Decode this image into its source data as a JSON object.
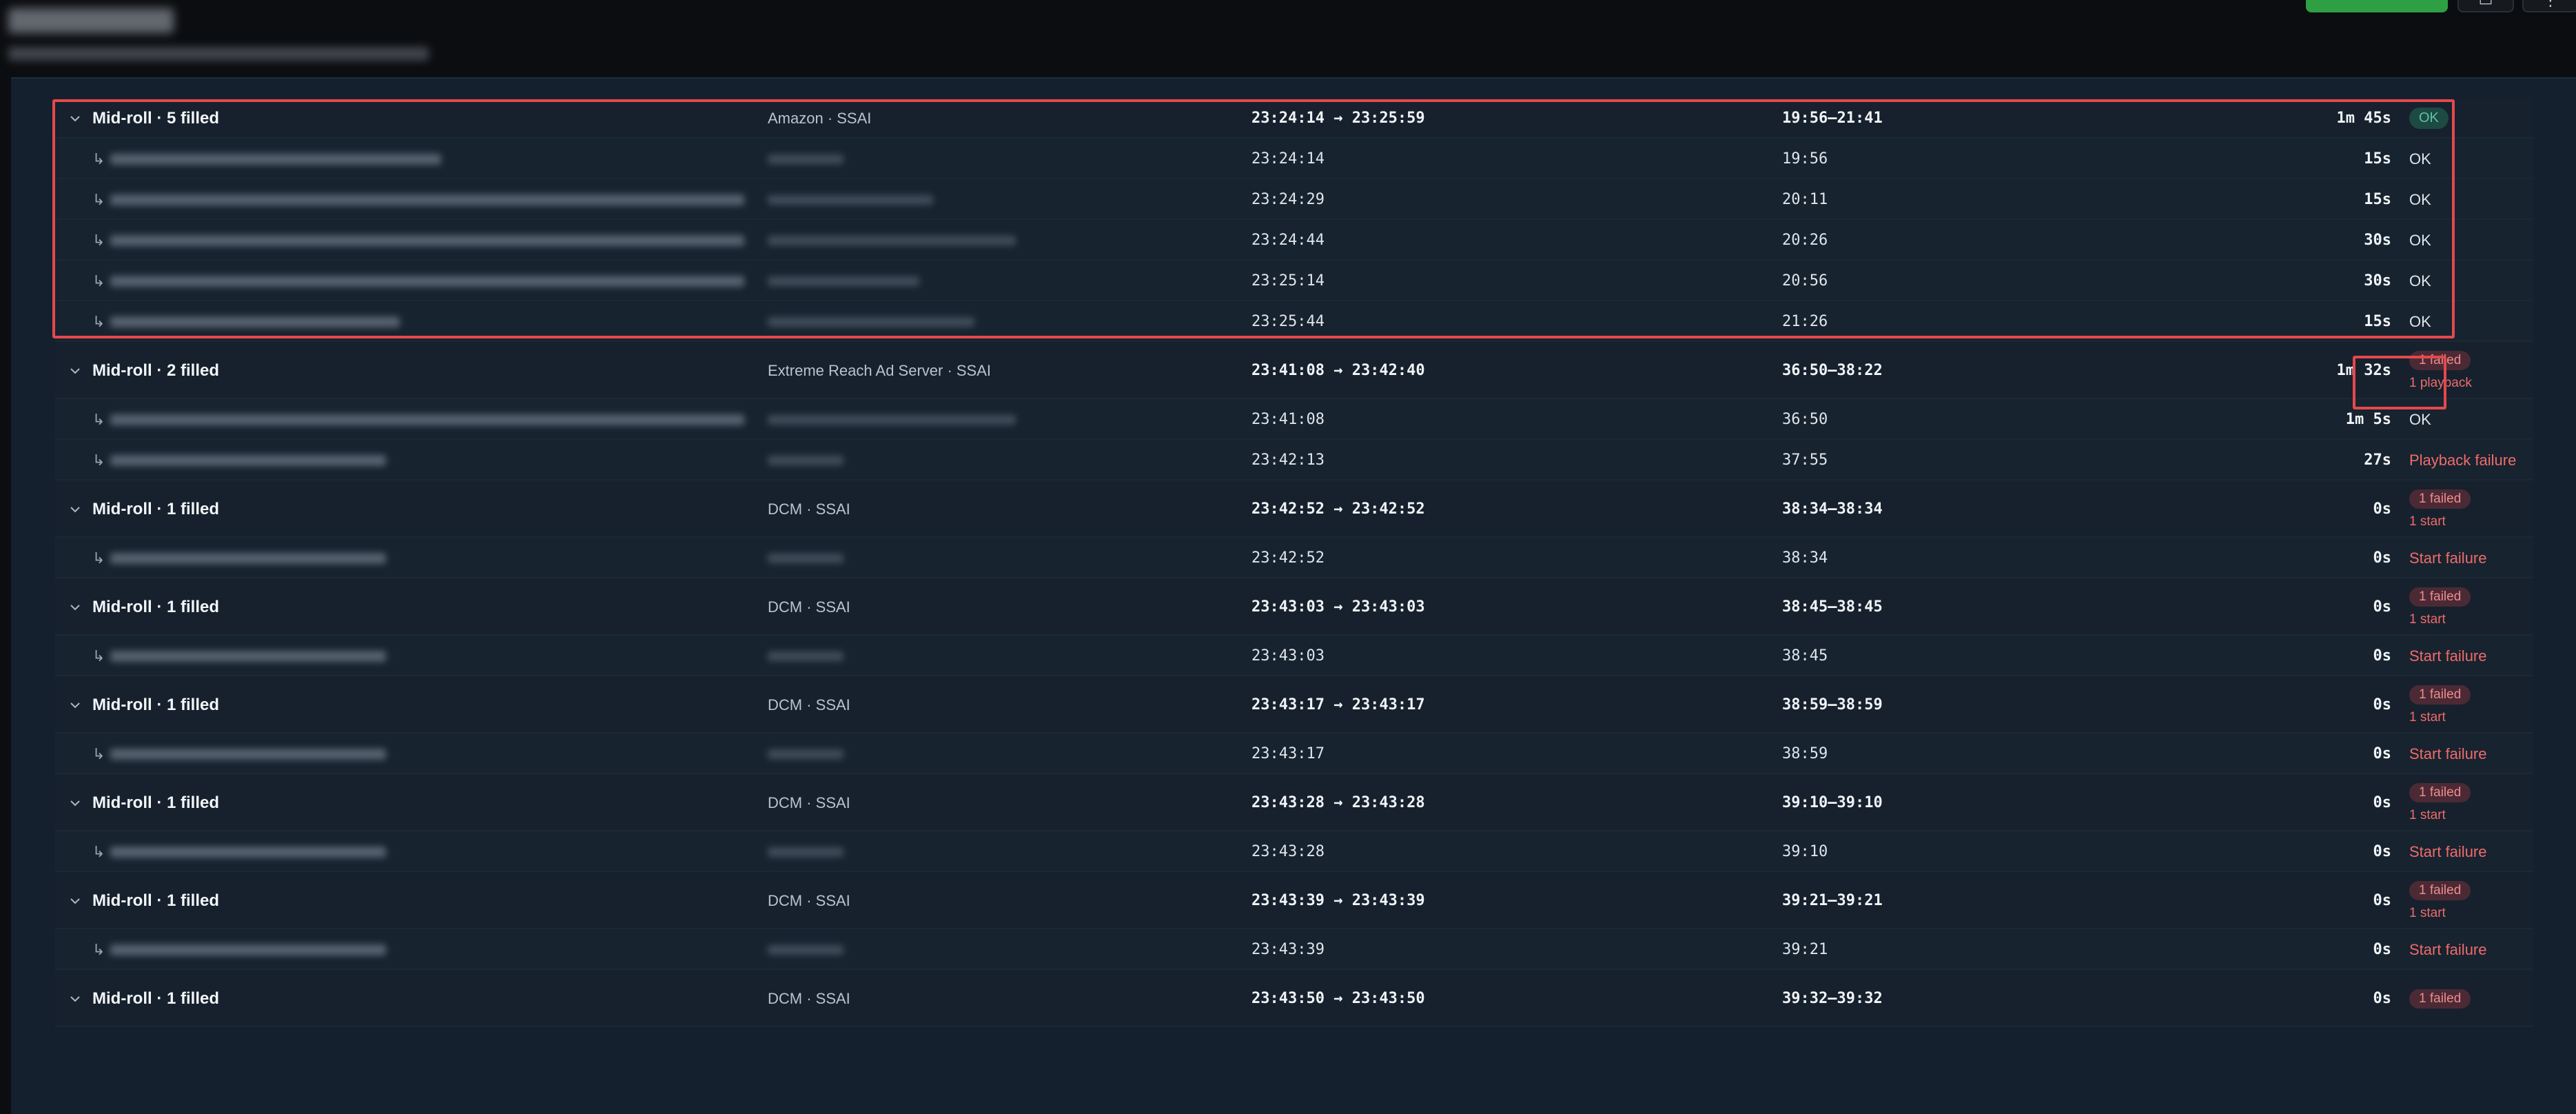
{
  "header": {
    "action_icons": [
      "panel-icon",
      "more-icon"
    ]
  },
  "rows": [
    {
      "kind": "group",
      "name": "Mid-roll · 5 filled",
      "provider": "Amazon · SSAI",
      "time": "23:24:14 → 23:25:59",
      "media": "19:56–21:41",
      "duration": "1m 45s",
      "status": "OK",
      "status_style": "pill-ok"
    },
    {
      "kind": "child",
      "blur": 480,
      "prov_blur": 110,
      "time": "23:24:14",
      "media": "19:56",
      "duration": "15s",
      "status": "OK"
    },
    {
      "kind": "child",
      "blur": 920,
      "prov_blur": 240,
      "time": "23:24:29",
      "media": "20:11",
      "duration": "15s",
      "status": "OK"
    },
    {
      "kind": "child",
      "blur": 920,
      "prov_blur": 360,
      "time": "23:24:44",
      "media": "20:26",
      "duration": "30s",
      "status": "OK"
    },
    {
      "kind": "child",
      "blur": 920,
      "prov_blur": 220,
      "time": "23:25:14",
      "media": "20:56",
      "duration": "30s",
      "status": "OK"
    },
    {
      "kind": "child",
      "blur": 420,
      "prov_blur": 300,
      "time": "23:25:44",
      "media": "21:26",
      "duration": "15s",
      "status": "OK"
    },
    {
      "kind": "group",
      "name": "Mid-roll · 2 filled",
      "provider": "Extreme Reach Ad Server · SSAI",
      "time": "23:41:08 → 23:42:40",
      "media": "36:50–38:22",
      "duration": "1m 32s",
      "status_pill": "1 failed",
      "status_sub": "1 playback"
    },
    {
      "kind": "child",
      "blur": 920,
      "prov_blur": 360,
      "time": "23:41:08",
      "media": "36:50",
      "duration": "1m 5s",
      "status": "OK"
    },
    {
      "kind": "child",
      "blur": 400,
      "prov_blur": 110,
      "time": "23:42:13",
      "media": "37:55",
      "duration": "27s",
      "status": "Playback failure",
      "status_style": "fail"
    },
    {
      "kind": "group",
      "name": "Mid-roll · 1 filled",
      "provider": "DCM · SSAI",
      "time": "23:42:52 → 23:42:52",
      "media": "38:34–38:34",
      "duration": "0s",
      "status_pill": "1 failed",
      "status_sub": "1 start"
    },
    {
      "kind": "child",
      "blur": 400,
      "prov_blur": 110,
      "time": "23:42:52",
      "media": "38:34",
      "duration": "0s",
      "status": "Start failure",
      "status_style": "fail"
    },
    {
      "kind": "group",
      "name": "Mid-roll · 1 filled",
      "provider": "DCM · SSAI",
      "time": "23:43:03 → 23:43:03",
      "media": "38:45–38:45",
      "duration": "0s",
      "status_pill": "1 failed",
      "status_sub": "1 start"
    },
    {
      "kind": "child",
      "blur": 400,
      "prov_blur": 110,
      "time": "23:43:03",
      "media": "38:45",
      "duration": "0s",
      "status": "Start failure",
      "status_style": "fail"
    },
    {
      "kind": "group",
      "name": "Mid-roll · 1 filled",
      "provider": "DCM · SSAI",
      "time": "23:43:17 → 23:43:17",
      "media": "38:59–38:59",
      "duration": "0s",
      "status_pill": "1 failed",
      "status_sub": "1 start"
    },
    {
      "kind": "child",
      "blur": 400,
      "prov_blur": 110,
      "time": "23:43:17",
      "media": "38:59",
      "duration": "0s",
      "status": "Start failure",
      "status_style": "fail"
    },
    {
      "kind": "group",
      "name": "Mid-roll · 1 filled",
      "provider": "DCM · SSAI",
      "time": "23:43:28 → 23:43:28",
      "media": "39:10–39:10",
      "duration": "0s",
      "status_pill": "1 failed",
      "status_sub": "1 start"
    },
    {
      "kind": "child",
      "blur": 400,
      "prov_blur": 110,
      "time": "23:43:28",
      "media": "39:10",
      "duration": "0s",
      "status": "Start failure",
      "status_style": "fail"
    },
    {
      "kind": "group",
      "name": "Mid-roll · 1 filled",
      "provider": "DCM · SSAI",
      "time": "23:43:39 → 23:43:39",
      "media": "39:21–39:21",
      "duration": "0s",
      "status_pill": "1 failed",
      "status_sub": "1 start"
    },
    {
      "kind": "child",
      "blur": 400,
      "prov_blur": 110,
      "time": "23:43:39",
      "media": "39:21",
      "duration": "0s",
      "status": "Start failure",
      "status_style": "fail"
    },
    {
      "kind": "group",
      "name": "Mid-roll · 1 filled",
      "provider": "DCM · SSAI",
      "time": "23:43:50 → 23:43:50",
      "media": "39:32–39:32",
      "duration": "0s",
      "status_pill": "1 failed",
      "status_sub": ""
    }
  ],
  "colors": {
    "panel_bg": "#14202d",
    "highlight": "#e5484d",
    "ok_pill": "#1d4a43",
    "fail_text": "#f06b6b",
    "action_green": "#2ea043"
  }
}
